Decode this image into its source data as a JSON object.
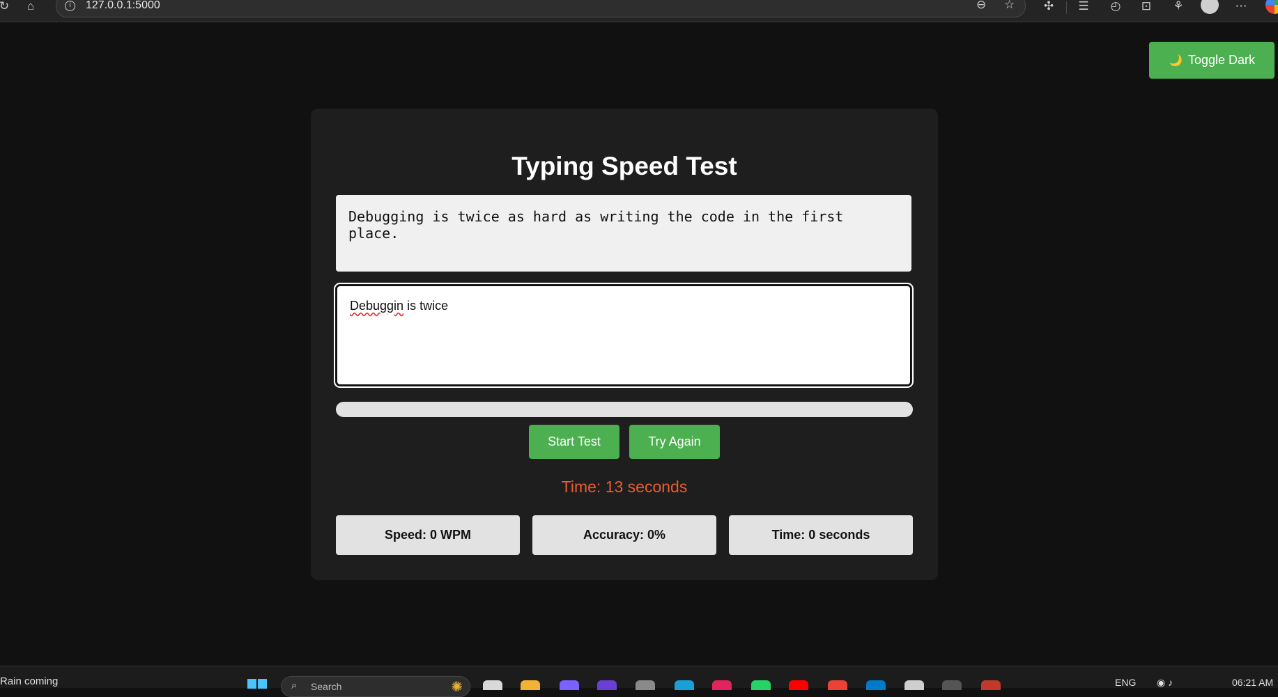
{
  "browser": {
    "url": "127.0.0.1:5000",
    "icons": [
      "refresh-icon",
      "home-icon",
      "info-icon",
      "zoom-out-icon",
      "favorite-star-icon",
      "extensions-icon",
      "favorites-icon",
      "history-icon",
      "screenshot-icon",
      "copilot-icon",
      "profile-icon",
      "more-icon"
    ]
  },
  "page": {
    "toggle_label": "Toggle Dark",
    "toggle_icon": "🌙",
    "title": "Typing Speed Test",
    "quote": "Debugging is twice as hard as writing the code in the first place.",
    "typed_word_misspelled": "Debuggin",
    "typed_rest": " is twice",
    "progress_fraction": 0,
    "start_label": "Start Test",
    "again_label": "Try Again",
    "timer": "Time: 13 seconds",
    "stats": {
      "speed": "Speed: 0 WPM",
      "accuracy": "Accuracy: 0%",
      "time": "Time: 0 seconds"
    },
    "colors": {
      "accent": "#4caf50",
      "timer": "#ef5b2e",
      "background": "#111111",
      "card": "#1e1e1e"
    }
  },
  "taskbar": {
    "weather": "Rain coming",
    "search_placeholder": "Search",
    "language": "ENG",
    "clock": "06:21 AM"
  }
}
